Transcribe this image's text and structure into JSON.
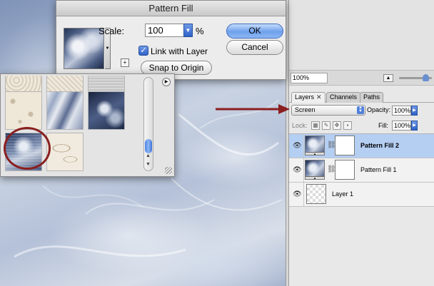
{
  "dialog": {
    "title": "Pattern Fill",
    "scale_label": "Scale:",
    "scale_value": "100",
    "scale_unit": "%",
    "link_with_layer_label": "Link with Layer",
    "link_with_layer_checked": true,
    "snap_to_origin_label": "Snap to Origin",
    "ok_label": "OK",
    "cancel_label": "Cancel"
  },
  "navigator": {
    "zoom_value": "100%"
  },
  "layers_panel": {
    "tabs": [
      {
        "label": "Layers",
        "active": true,
        "closable": true
      },
      {
        "label": "Channels",
        "active": false
      },
      {
        "label": "Paths",
        "active": false
      }
    ],
    "blend_mode": "Screen",
    "opacity_label": "Opacity:",
    "opacity_value": "100%",
    "lock_label": "Lock:",
    "fill_label": "Fill:",
    "fill_value": "100%",
    "layers": [
      {
        "name": "Pattern Fill 2",
        "selected": true,
        "visible": true,
        "type": "pattern-fill"
      },
      {
        "name": "Pattern Fill 1",
        "selected": false,
        "visible": true,
        "type": "pattern-fill"
      },
      {
        "name": "Layer 1",
        "selected": false,
        "visible": true,
        "type": "raster"
      }
    ]
  },
  "colors": {
    "accent_blue": "#2f62c8",
    "selection_highlight": "#b5cff3",
    "annotation_red": "#8a1f1f"
  }
}
